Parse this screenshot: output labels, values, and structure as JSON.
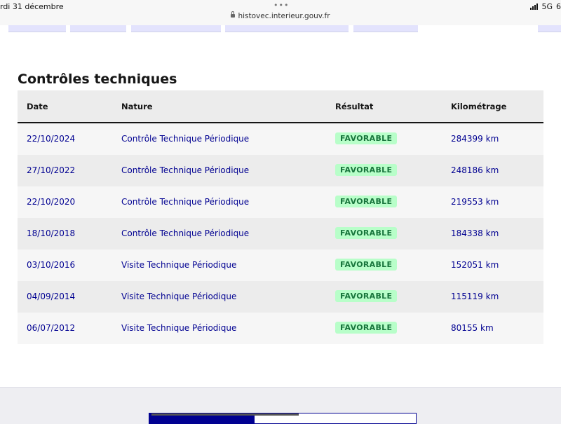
{
  "status_bar": {
    "time": "rdi 31 décembre",
    "url": "histovec.interieur.gouv.fr",
    "network": "5G",
    "battery": "6"
  },
  "section": {
    "title": "Contrôles techniques"
  },
  "table": {
    "headers": {
      "date": "Date",
      "nature": "Nature",
      "result": "Résultat",
      "mileage": "Kilométrage"
    },
    "rows": [
      {
        "date": "22/10/2024",
        "nature": "Contrôle Technique Périodique",
        "result": "FAVORABLE",
        "mileage": "284399 km"
      },
      {
        "date": "27/10/2022",
        "nature": "Contrôle Technique Périodique",
        "result": "FAVORABLE",
        "mileage": "248186 km"
      },
      {
        "date": "22/10/2020",
        "nature": "Contrôle Technique Périodique",
        "result": "FAVORABLE",
        "mileage": "219553 km"
      },
      {
        "date": "18/10/2018",
        "nature": "Contrôle Technique Périodique",
        "result": "FAVORABLE",
        "mileage": "184338 km"
      },
      {
        "date": "03/10/2016",
        "nature": "Visite Technique Périodique",
        "result": "FAVORABLE",
        "mileage": "152051 km"
      },
      {
        "date": "04/09/2014",
        "nature": "Visite Technique Périodique",
        "result": "FAVORABLE",
        "mileage": "115119 km"
      },
      {
        "date": "06/07/2012",
        "nature": "Visite Technique Périodique",
        "result": "FAVORABLE",
        "mileage": "80155 km"
      }
    ]
  },
  "colors": {
    "link_blue": "#000091",
    "badge_bg": "#b8fec9",
    "badge_text": "#18753c"
  }
}
